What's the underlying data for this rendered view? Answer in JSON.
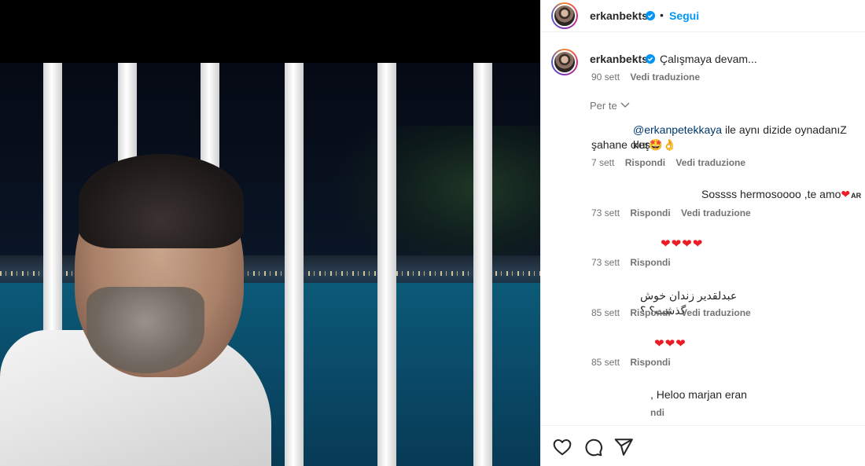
{
  "header": {
    "username": "erkanbekts",
    "separator": "•",
    "follow_label": "Segui"
  },
  "caption": {
    "username": "erkanbekts",
    "text": "Çalışmaya devam...",
    "time": "90 sett",
    "translate_label": "Vedi traduzione"
  },
  "filter": {
    "label": "Per te"
  },
  "comments": [
    {
      "mention": "@erkanpetekkaya",
      "text_line1": " ile aynı dizide oynadanıZ keşke",
      "text_line2": "şahane olur🤩👌",
      "time": "7 sett",
      "reply": "Rispondi",
      "translate": "Vedi traduzione"
    },
    {
      "text": "Sossss hermosoooo ,te amo",
      "suffix": "AR",
      "time": "73 sett",
      "reply": "Rispondi",
      "translate": "Vedi traduzione"
    },
    {
      "hearts": "❤❤❤❤",
      "time": "73 sett",
      "reply": "Rispondi"
    },
    {
      "text": "عبدلقدیر زندان خوش گذشت؟ ؟",
      "time": "85 sett",
      "reply": "Rispondi",
      "translate": "Vedi traduzione"
    },
    {
      "hearts": "❤❤❤",
      "time": "85 sett",
      "reply": "Rispondi"
    },
    {
      "text": ", Heloo marjan eran",
      "reply_partial": "ndi"
    }
  ],
  "actions": {
    "like_icon": "heart-icon",
    "comment_icon": "comment-icon",
    "share_icon": "share-icon"
  },
  "colors": {
    "link_blue": "#0095f6",
    "mention_blue": "#00376b",
    "muted": "#737373",
    "heart_red": "#ed1c24"
  }
}
